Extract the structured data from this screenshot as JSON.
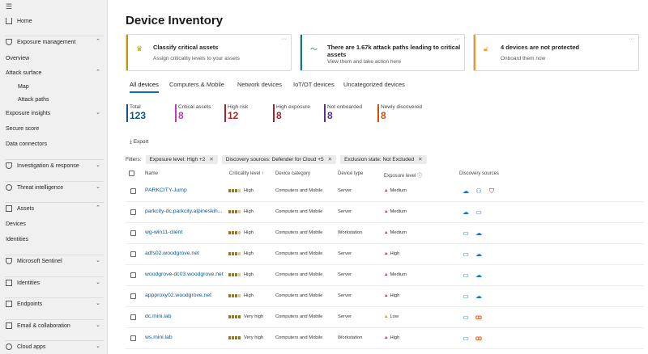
{
  "sidebar": {
    "menu_icon": "hamburger-icon",
    "items": [
      {
        "label": "Home",
        "icon": "home-icon",
        "kind": "item"
      },
      {
        "label": "Exposure management",
        "icon": "shield-icon",
        "kind": "group",
        "expanded": true
      },
      {
        "label": "Overview",
        "kind": "child"
      },
      {
        "label": "Attack surface",
        "kind": "child",
        "expanded": true
      },
      {
        "label": "Map",
        "kind": "sub"
      },
      {
        "label": "Attack paths",
        "kind": "sub"
      },
      {
        "label": "Exposure insights",
        "kind": "child",
        "expanded": false
      },
      {
        "label": "Secure score",
        "kind": "child"
      },
      {
        "label": "Data connectors",
        "kind": "child"
      },
      {
        "label": "Investigation & response",
        "icon": "shield-icon",
        "kind": "group",
        "expanded": false
      },
      {
        "label": "Threat intelligence",
        "icon": "bug-icon",
        "kind": "group",
        "expanded": false
      },
      {
        "label": "Assets",
        "icon": "assets-icon",
        "kind": "group",
        "expanded": true
      },
      {
        "label": "Devices",
        "kind": "child"
      },
      {
        "label": "Identities",
        "kind": "child"
      },
      {
        "label": "Microsoft Sentinel",
        "icon": "sentinel-icon",
        "kind": "group",
        "expanded": false
      },
      {
        "label": "Identities",
        "icon": "identity-icon",
        "kind": "group",
        "expanded": false
      },
      {
        "label": "Endpoints",
        "icon": "endpoint-icon",
        "kind": "group",
        "expanded": false
      },
      {
        "label": "Email & collaboration",
        "icon": "mail-icon",
        "kind": "group",
        "expanded": false
      },
      {
        "label": "Cloud apps",
        "icon": "cloud-icon",
        "kind": "group",
        "expanded": false
      }
    ]
  },
  "page": {
    "title": "Device Inventory"
  },
  "cards": [
    {
      "title": "Classify critical assets",
      "subtitle": "Assign criticality levels to your assets",
      "icon": "crown-icon",
      "accent": "#c19c00"
    },
    {
      "title": "There are 1.67k attack paths leading to critical assets",
      "subtitle": "View them and take action here",
      "icon": "attack-path-icon",
      "accent": "#0e7a7a"
    },
    {
      "title": "4 devices are not protected",
      "subtitle": "Onboard them now",
      "icon": "lock-icon",
      "accent": "#f7941d"
    }
  ],
  "tabs": [
    "All devices",
    "Computers & Mobile",
    "Network devices",
    "IoT/OT devices",
    "Uncategorized devices"
  ],
  "stats": [
    {
      "label": "Total",
      "value": "123",
      "color": "#0f548c"
    },
    {
      "label": "Critical assets",
      "value": "8",
      "color": "#c239b3"
    },
    {
      "label": "High risk",
      "value": "12",
      "color": "#a4262c"
    },
    {
      "label": "High exposure",
      "value": "8",
      "color": "#a4262c"
    },
    {
      "label": "Not onboarded",
      "value": "8",
      "color": "#5c2e91"
    },
    {
      "label": "Newly discovered",
      "value": "8",
      "color": "#ca5010"
    }
  ],
  "toolbar": {
    "export_label": "Export"
  },
  "filters": {
    "label": "Filters:",
    "chips": [
      "Exposure level: High +2",
      "Discovery sources: Defender for Cloud +5",
      "Exclusion state: Not Excluded"
    ]
  },
  "table": {
    "columns": [
      "Name",
      "Criticality level",
      "Device category",
      "Device type",
      "Exposure level",
      "Discovery sources"
    ],
    "sort_indicator": "↑",
    "rows": [
      {
        "name": "PARKCITY-Jump",
        "criticality": "High",
        "crit_level": 3,
        "category": "Computers and Mobile",
        "type": "Server",
        "exposure": "Medium",
        "sources": [
          "cloud-icon",
          "identity-icon",
          "defender-icon"
        ]
      },
      {
        "name": "parkcity-dc.parkcity.alpineskih...",
        "criticality": "High",
        "crit_level": 3,
        "category": "Computers and Mobile",
        "type": "Server",
        "exposure": "Medium",
        "sources": [
          "cloud-icon",
          "device-icon"
        ]
      },
      {
        "name": "wg-win11-client",
        "criticality": "High",
        "crit_level": 3,
        "category": "Computers and Mobile",
        "type": "Workstation",
        "exposure": "Medium",
        "sources": [
          "device-icon",
          "cloud-icon"
        ]
      },
      {
        "name": "adfs02.woodgrove.net",
        "criticality": "High",
        "crit_level": 3,
        "category": "Computers and Mobile",
        "type": "Server",
        "exposure": "High",
        "sources": [
          "device-icon",
          "cloud-icon"
        ]
      },
      {
        "name": "woodgrove-dc03.woodgrove.net",
        "criticality": "High",
        "crit_level": 3,
        "category": "Computers and Mobile",
        "type": "Server",
        "exposure": "Medium",
        "sources": [
          "device-icon",
          "cloud-icon"
        ]
      },
      {
        "name": "appproxy02.woodgrove.net",
        "criticality": "High",
        "crit_level": 3,
        "category": "Computers and Mobile",
        "type": "Server",
        "exposure": "High",
        "sources": [
          "device-icon",
          "cloud-icon"
        ]
      },
      {
        "name": "dc.mini.lab",
        "criticality": "Very high",
        "crit_level": 4,
        "category": "Computers and Mobile",
        "type": "Server",
        "exposure": "Low",
        "sources": [
          "device-icon",
          "orange-icon"
        ]
      },
      {
        "name": "ws.mini.lab",
        "criticality": "Very high",
        "crit_level": 4,
        "category": "Computers and Mobile",
        "type": "Workstation",
        "exposure": "High",
        "sources": [
          "device-icon",
          "orange-icon"
        ]
      }
    ]
  }
}
